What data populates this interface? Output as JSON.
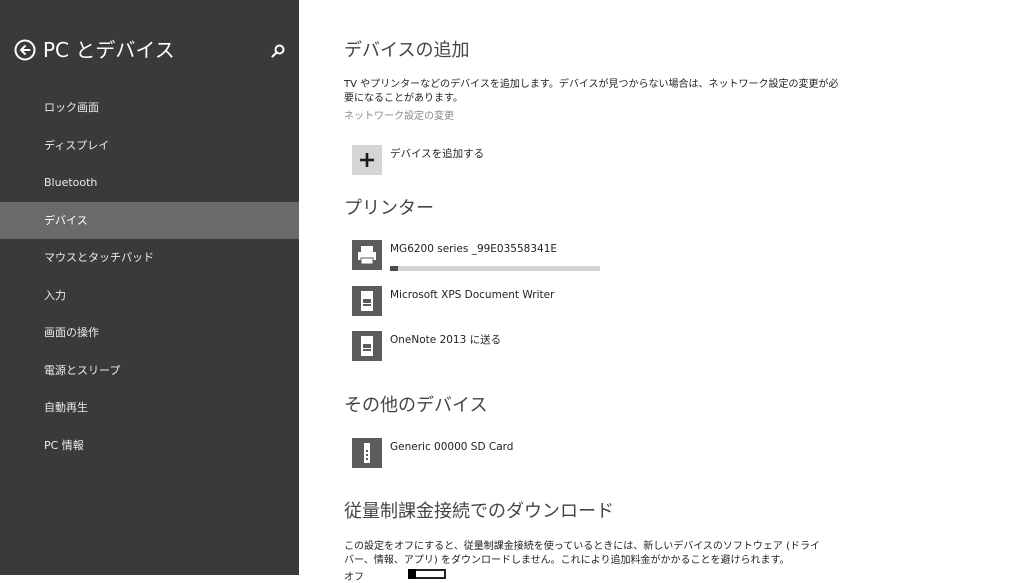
{
  "sidebar": {
    "title": "PC とデバイス",
    "back_icon": "back-arrow-circle-icon",
    "search_icon": "search-icon",
    "items": [
      {
        "label": "ロック画面",
        "selected": false
      },
      {
        "label": "ディスプレイ",
        "selected": false
      },
      {
        "label": "Bluetooth",
        "selected": false
      },
      {
        "label": "デバイス",
        "selected": true
      },
      {
        "label": "マウスとタッチパッド",
        "selected": false
      },
      {
        "label": "入力",
        "selected": false
      },
      {
        "label": "画面の操作",
        "selected": false
      },
      {
        "label": "電源とスリープ",
        "selected": false
      },
      {
        "label": "自動再生",
        "selected": false
      },
      {
        "label": "PC 情報",
        "selected": false
      }
    ]
  },
  "main": {
    "add_devices": {
      "title": "デバイスの追加",
      "description_line1": "TV やプリンターなどのデバイスを追加します。デバイスが見つからない場合は、ネットワーク設定の変更が必",
      "description_line2": "要になることがあります。",
      "network_link": "ネットワーク設定の変更",
      "add_button_label": "デバイスを追加する",
      "add_icon": "plus-icon"
    },
    "printers": {
      "title": "プリンター",
      "items": [
        {
          "label": "MG6200 series _99E03558341E",
          "icon": "printer-icon",
          "progress": 0.04
        },
        {
          "label": "Microsoft XPS Document Writer",
          "icon": "document-printer-icon"
        },
        {
          "label": "OneNote 2013 に送る",
          "icon": "document-printer-icon"
        }
      ]
    },
    "other_devices": {
      "title": "その他のデバイス",
      "items": [
        {
          "label": "Generic 00000 SD Card",
          "icon": "storage-device-icon"
        }
      ]
    },
    "metered": {
      "title": "従量制課金接続でのダウンロード",
      "description_line1": "この設定をオフにすると、従量制課金接続を使っているときには、新しいデバイスのソフトウェア (ドライ",
      "description_line2": "バー、情報、アプリ) をダウンロードしません。これにより追加料金がかかることを避けられます。",
      "toggle_label": "オフ",
      "toggle_on": false
    }
  }
}
